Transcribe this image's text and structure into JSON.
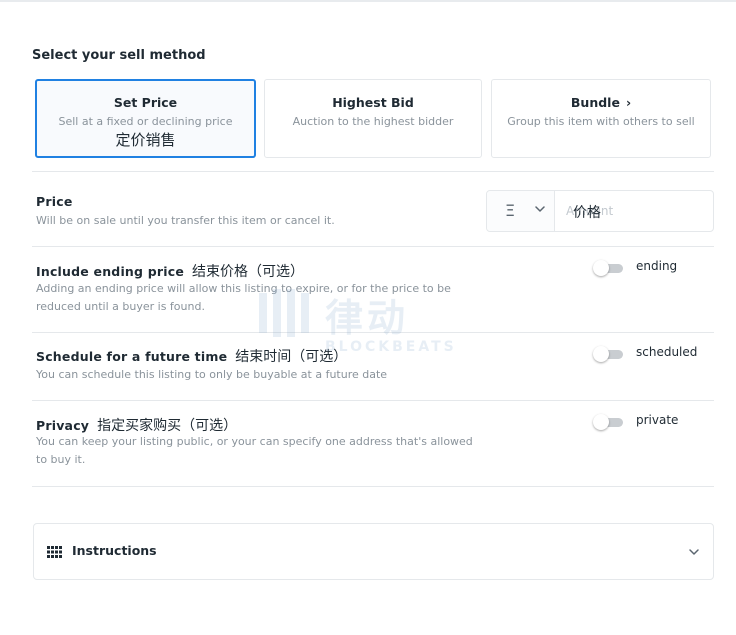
{
  "sell_method": {
    "heading": "Select your sell method",
    "options": [
      {
        "title": "Set Price",
        "description": "Sell at a fixed or declining price",
        "note": "定价销售",
        "selected": true
      },
      {
        "title": "Highest Bid",
        "description": "Auction to the highest bidder",
        "selected": false
      },
      {
        "title": "Bundle",
        "description": "Group this item with others to sell",
        "selected": false
      }
    ]
  },
  "price": {
    "title": "Price",
    "description": "Will be on sale until you transfer this item or cancel it.",
    "currency_symbol": "Ξ",
    "currency_icon": "ethereum-icon",
    "amount_placeholder": "Amount",
    "amount_overlay": "价格"
  },
  "ending_price": {
    "title": "Include ending price",
    "title_note": "结束价格（可选）",
    "description": "Adding an ending price will allow this listing to expire, or for the price to be reduced until a buyer is found.",
    "toggle_label": "ending",
    "enabled": false
  },
  "schedule": {
    "title": "Schedule for a future time",
    "title_note": "结束时间（可选）",
    "description": "You can schedule this listing to only be buyable at a future date",
    "toggle_label": "scheduled",
    "enabled": false
  },
  "privacy": {
    "title": "Privacy",
    "title_note": "指定买家购买（可选）",
    "description": "You can keep your listing public, or your can specify one address that's allowed to buy it.",
    "toggle_label": "private",
    "enabled": false
  },
  "watermark": {
    "cn": "律动",
    "en": "BLOCKBEATS"
  },
  "instructions": {
    "label": "Instructions",
    "icon": "grid-icon"
  },
  "colors": {
    "accent": "#2081e2",
    "text": "#1f2a33",
    "muted": "#8a939b",
    "border": "#e5e8eb"
  }
}
